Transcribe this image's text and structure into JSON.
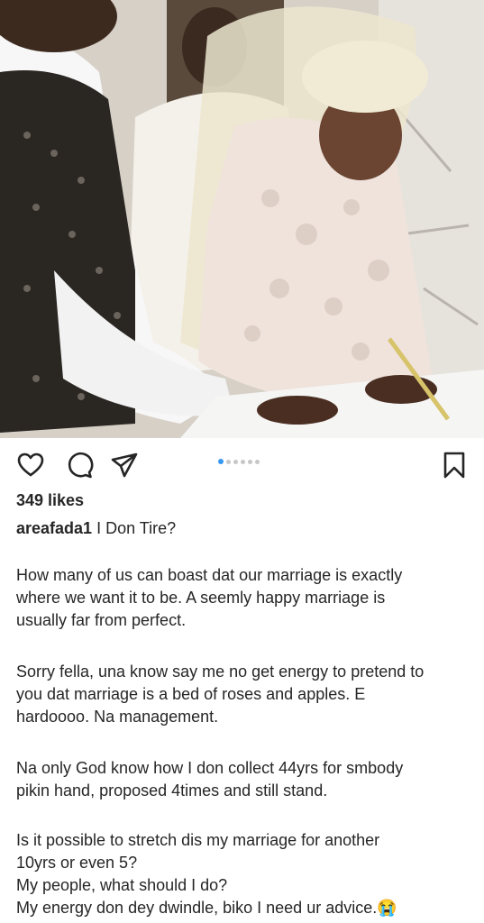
{
  "post": {
    "likes": "349 likes",
    "username": "areafada1",
    "caption_title": " I Don Tire?",
    "paragraphs": [
      "How many of us can boast dat our marriage is exactly\nwhere we want it to be. A seemly happy marriage is\nusually far from perfect.",
      "Sorry fella, una know say me no get energy to pretend to\nyou dat marriage is a bed of roses and apples. E\nhardoooo. Na management.",
      "Na only God know how I don collect 44yrs for smbody\npikin hand, proposed 4times and still stand.",
      "Is it possible to stretch dis my marriage for another\n10yrs or even 5?\nMy people, what should I do?\nMy energy don dey dwindle, biko I need ur advice.😭"
    ]
  },
  "carousel": {
    "count": 6,
    "active_index": 0
  },
  "icons": {
    "like": "heart-icon",
    "comment": "comment-icon",
    "share": "paper-plane-icon",
    "save": "bookmark-icon"
  },
  "colors": {
    "text": "#262626",
    "active_dot": "#3897f0",
    "inactive_dot": "#c7c7c7"
  }
}
